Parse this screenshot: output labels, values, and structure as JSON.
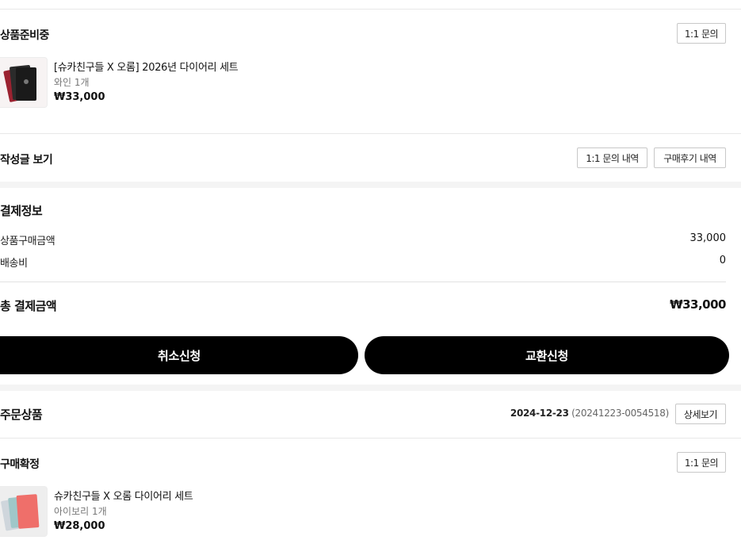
{
  "order1": {
    "status": "상품준비중",
    "inquiry_button": "1:1 문의",
    "product": {
      "name": "[슈카친구들 X 오롬] 2026년 다이어리 세트",
      "option": "와인 1개",
      "price": "₩33,000"
    }
  },
  "posts": {
    "label": "작성글 보기",
    "inquiry_history_button": "1:1 문의 내역",
    "review_history_button": "구매후기 내역"
  },
  "payment": {
    "title": "결제정보",
    "rows": [
      {
        "label": "상품구매금액",
        "value": "33,000"
      },
      {
        "label": "배송비",
        "value": "0"
      }
    ],
    "total_label": "총 결제금액",
    "total_value": "₩33,000"
  },
  "actions": {
    "cancel_label": "취소신청",
    "exchange_label": "교환신청"
  },
  "order2": {
    "section_title": "주문상품",
    "date": "2024-12-23",
    "order_number": "(20241223-0054518)",
    "detail_button": "상세보기",
    "status": "구매확정",
    "inquiry_button": "1:1 문의",
    "product": {
      "name": "슈카친구들 X 오롬 다이어리 세트",
      "option": "아이보리 1개",
      "price": "₩28,000"
    }
  },
  "colors": {
    "background": "#f4f4f4",
    "primary_button": "#000000",
    "divider": "#e8e8e8"
  }
}
